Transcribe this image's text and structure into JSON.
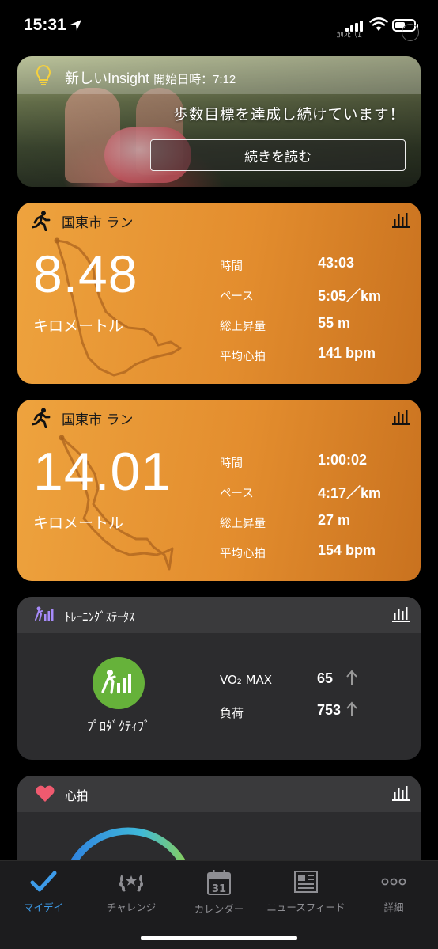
{
  "status_bar": {
    "time": "15:31",
    "carrier": "ｶﾘﾝﾋﾞﾘﾑ"
  },
  "insight": {
    "title": "新しいInsight",
    "start_label": "開始日時：7:12",
    "message": "歩数目標を達成し続けています！",
    "button": "続きを読む"
  },
  "activities": [
    {
      "title": "国東市 ラン",
      "distance": "8.48",
      "unit": "キロメートル",
      "stats": [
        {
          "label": "時間",
          "value": "43:03"
        },
        {
          "label": "ペース",
          "value": "5:05／km"
        },
        {
          "label": "総上昇量",
          "value": "55 m"
        },
        {
          "label": "平均心拍",
          "value": "141 bpm"
        }
      ]
    },
    {
      "title": "国東市 ラン",
      "distance": "14.01",
      "unit": "キロメートル",
      "stats": [
        {
          "label": "時間",
          "value": "1:00:02"
        },
        {
          "label": "ペース",
          "value": "4:17／km"
        },
        {
          "label": "総上昇量",
          "value": "27 m"
        },
        {
          "label": "平均心拍",
          "value": "154 bpm"
        }
      ]
    }
  ],
  "training": {
    "title": "ﾄﾚｰﾆﾝｸﾞｽﾃｰﾀｽ",
    "status": "ﾌﾟﾛﾀﾞｸﾃｨﾌﾞ",
    "stats": [
      {
        "label": "VO₂ MAX",
        "value": "65"
      },
      {
        "label": "負荷",
        "value": "753"
      }
    ]
  },
  "heart": {
    "title": "心拍"
  },
  "tabs": [
    {
      "label": "マイデイ",
      "icon": "check-icon"
    },
    {
      "label": "チャレンジ",
      "icon": "laurel-icon"
    },
    {
      "label": "カレンダー",
      "icon": "calendar-icon",
      "date": "31"
    },
    {
      "label": "ニュースフィード",
      "icon": "newspaper-icon"
    },
    {
      "label": "詳細",
      "icon": "more-icon"
    }
  ],
  "colors": {
    "accent": "#3d9be9",
    "activity": "#e89534",
    "productive": "#66b23a"
  }
}
